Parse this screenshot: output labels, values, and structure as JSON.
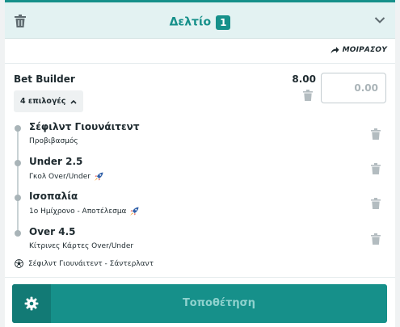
{
  "header": {
    "title": "Δελτίο",
    "badge_count": "1"
  },
  "share": {
    "label": "ΜΟΙΡΑΣΟΥ"
  },
  "bet": {
    "title": "Bet Builder",
    "odds": "8.00",
    "stake_placeholder": "0.00",
    "selections_label": "4 επιλογές"
  },
  "selections": [
    {
      "name": "Σέφιλντ Γιουνάιτεντ",
      "market": "Προβιβασμός",
      "boosted": false
    },
    {
      "name": "Under 2.5",
      "market": "Γκολ Over/Under",
      "boosted": true
    },
    {
      "name": "Ισοπαλία",
      "market": "1ο Ημίχρονο - Αποτέλεσμα",
      "boosted": true
    },
    {
      "name": "Over 4.5",
      "market": "Κίτρινες Κάρτες Over/Under",
      "boosted": false
    }
  ],
  "event": {
    "label": "Σέφιλντ Γιουνάιτεντ - Σάντερλαντ"
  },
  "footer": {
    "place_label": "Τοποθέτηση"
  },
  "colors": {
    "accent": "#16908a",
    "header_bg": "#e3f2f2",
    "place_text": "#8fd2ce"
  },
  "icons": {
    "clear_all": "trash-icon",
    "collapse": "chevron-down-icon",
    "share": "share-arrow-icon",
    "selections_toggle": "chevron-up-icon",
    "boost": "rocket-icon",
    "sport": "soccer-ball-icon",
    "settings": "gear-icon"
  }
}
